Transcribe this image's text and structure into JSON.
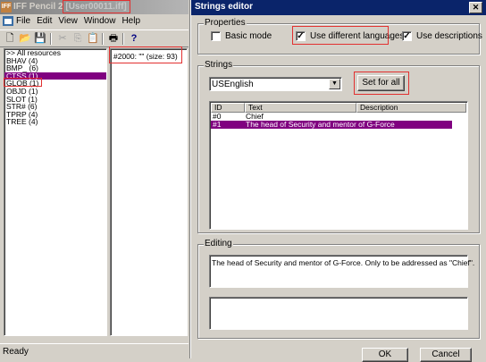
{
  "main_window": {
    "app_icon": "IFF",
    "title": "IFF Pencil 2",
    "file": "[User00011.iff]",
    "menu": [
      "File",
      "Edit",
      "View",
      "Window",
      "Help"
    ],
    "resource_list": [
      ">> All resources",
      "BHAV (4)",
      "BMP_ (6)",
      "CTSS (1)",
      "GLOB (1)",
      "OBJD (1)",
      "SLOT (1)",
      "STR# (6)",
      "TPRP (4)",
      "TREE (4)"
    ],
    "selected_resource_index": 3,
    "item_list": [
      "#2000: \"\" (size: 93)"
    ],
    "status": "Ready",
    "icons": [
      "new-icon",
      "open-icon",
      "save-icon",
      "cut-icon",
      "copy-icon",
      "paste-icon",
      "print-icon",
      "help-icon"
    ]
  },
  "dialog": {
    "title": "Strings editor",
    "close_glyph": "✕",
    "properties": {
      "legend": "Properties",
      "basic_mode": {
        "label": "Basic mode",
        "checked": false
      },
      "use_languages": {
        "label": "Use different languages",
        "checked": true
      },
      "use_descriptions": {
        "label": "Use descriptions",
        "checked": true
      }
    },
    "strings": {
      "legend": "Strings",
      "language": "USEnglish",
      "set_for_all": "Set for all",
      "columns": [
        "ID",
        "Text",
        "Description"
      ],
      "rows": [
        {
          "id": "#0",
          "text": "Chief",
          "description": ""
        },
        {
          "id": "#1",
          "text": "The head of Security and mentor of G-Force",
          "description": ""
        }
      ],
      "selected_row": 1
    },
    "editing": {
      "legend": "Editing",
      "text": "The head of Security and mentor of G-Force. Only to be addressed as \"Chief\".",
      "description": ""
    },
    "ok": "OK",
    "cancel": "Cancel"
  },
  "colors": {
    "selection": "#800080",
    "highlight_box": "#e23030",
    "dialog_title": "#0a246a"
  }
}
